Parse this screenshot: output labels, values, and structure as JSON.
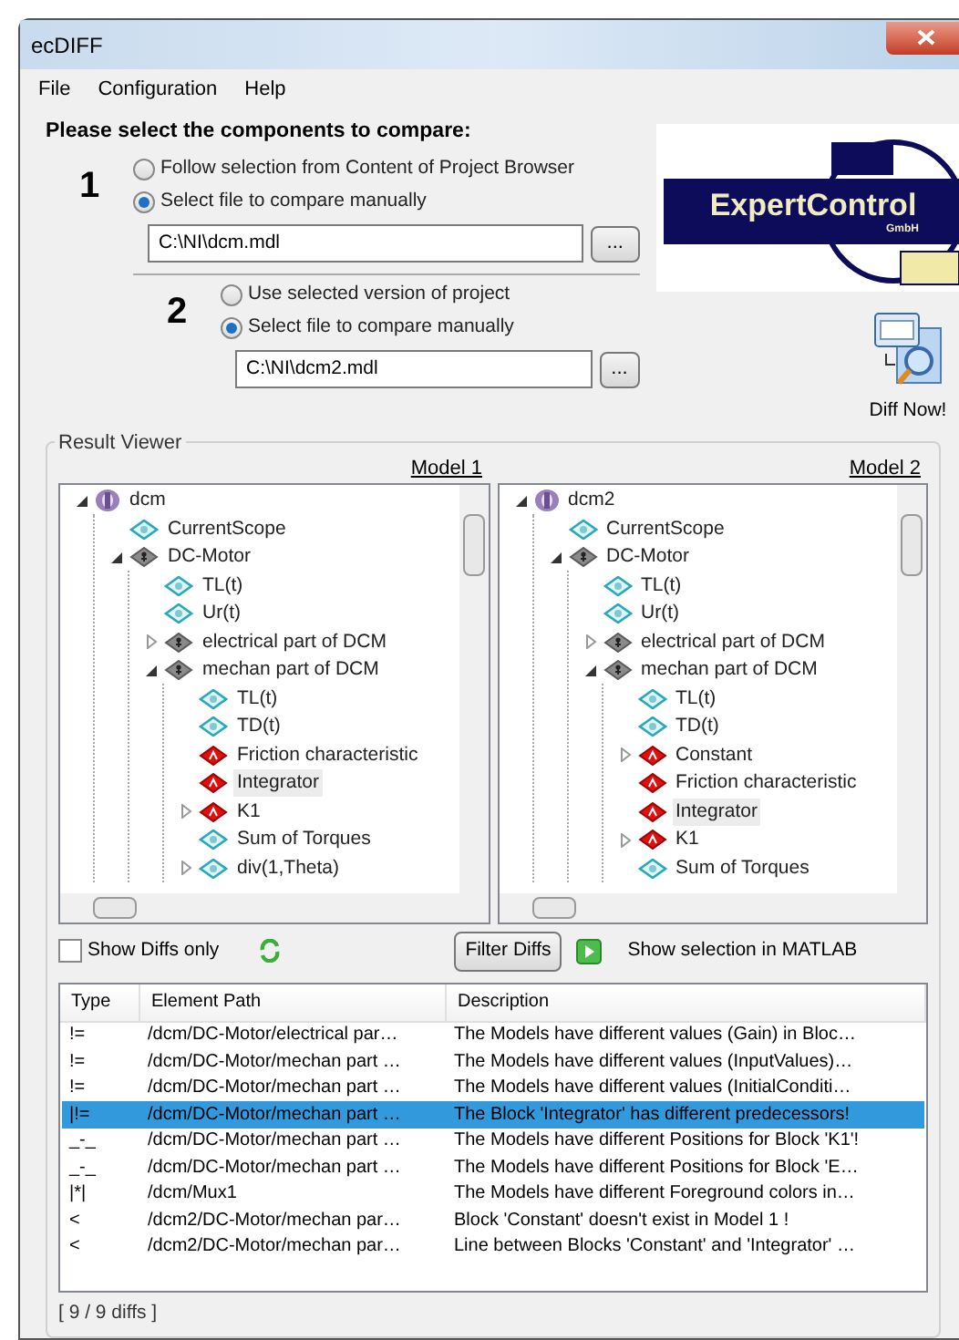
{
  "window": {
    "title": "ecDIFF"
  },
  "menu": [
    "File",
    "Configuration",
    "Help"
  ],
  "heading": "Please select the components to compare:",
  "sources": [
    {
      "number": "1",
      "options": [
        {
          "label": "Follow selection from Content of Project Browser",
          "selected": false
        },
        {
          "label": "Select file to compare manually",
          "selected": true
        }
      ],
      "path": "C:\\NI\\dcm.mdl",
      "browse": "..."
    },
    {
      "number": "2",
      "options": [
        {
          "label": "Use selected version of project",
          "selected": false
        },
        {
          "label": "Select file to compare manually",
          "selected": true
        }
      ],
      "path": "C:\\NI\\dcm2.mdl",
      "browse": "..."
    }
  ],
  "logo": {
    "name": "ExpertControl",
    "suffix": "GmbH"
  },
  "diff_button": "Diff Now!",
  "result_viewer": {
    "title": "Result Viewer",
    "models": [
      {
        "label": "Model 1",
        "tree": [
          {
            "label": "dcm",
            "kind": "model",
            "expanded": true,
            "selected": false,
            "children": [
              {
                "label": "CurrentScope",
                "kind": "block",
                "selected": false
              },
              {
                "label": "DC-Motor",
                "kind": "subsystem",
                "expanded": true,
                "selected": false,
                "children": [
                  {
                    "label": "TL(t)",
                    "kind": "block",
                    "selected": false
                  },
                  {
                    "label": "Ur(t)",
                    "kind": "block",
                    "selected": false
                  },
                  {
                    "label": "electrical part of DCM",
                    "kind": "subsystem",
                    "expanded": false,
                    "selected": false
                  },
                  {
                    "label": "mechan part of DCM",
                    "kind": "subsystem",
                    "expanded": true,
                    "selected": false,
                    "children": [
                      {
                        "label": "TL(t)",
                        "kind": "block",
                        "selected": false
                      },
                      {
                        "label": "TD(t)",
                        "kind": "block",
                        "selected": false
                      },
                      {
                        "label": "Friction characteristic",
                        "kind": "changed",
                        "selected": false
                      },
                      {
                        "label": "Integrator",
                        "kind": "changed",
                        "selected": true
                      },
                      {
                        "label": "K1",
                        "kind": "changed",
                        "expanded": false,
                        "selected": false
                      },
                      {
                        "label": "Sum of Torques",
                        "kind": "block",
                        "selected": false
                      },
                      {
                        "label": "div(1,Theta)",
                        "kind": "block",
                        "expanded": false,
                        "selected": false
                      }
                    ]
                  }
                ]
              }
            ]
          }
        ]
      },
      {
        "label": "Model 2",
        "tree": [
          {
            "label": "dcm2",
            "kind": "model",
            "expanded": true,
            "selected": false,
            "children": [
              {
                "label": "CurrentScope",
                "kind": "block",
                "selected": false
              },
              {
                "label": "DC-Motor",
                "kind": "subsystem",
                "expanded": true,
                "selected": false,
                "children": [
                  {
                    "label": "TL(t)",
                    "kind": "block",
                    "selected": false
                  },
                  {
                    "label": "Ur(t)",
                    "kind": "block",
                    "selected": false
                  },
                  {
                    "label": "electrical part of DCM",
                    "kind": "subsystem",
                    "expanded": false,
                    "selected": false
                  },
                  {
                    "label": "mechan part of DCM",
                    "kind": "subsystem",
                    "expanded": true,
                    "selected": false,
                    "children": [
                      {
                        "label": "TL(t)",
                        "kind": "block",
                        "selected": false
                      },
                      {
                        "label": "TD(t)",
                        "kind": "block",
                        "selected": false
                      },
                      {
                        "label": "Constant",
                        "kind": "changed",
                        "expanded": false,
                        "selected": false
                      },
                      {
                        "label": "Friction characteristic",
                        "kind": "changed",
                        "selected": false
                      },
                      {
                        "label": "Integrator",
                        "kind": "changed",
                        "selected": true
                      },
                      {
                        "label": "K1",
                        "kind": "changed",
                        "expanded": false,
                        "selected": false
                      },
                      {
                        "label": "Sum of Torques",
                        "kind": "block",
                        "selected": false
                      }
                    ]
                  }
                ]
              }
            ]
          }
        ]
      }
    ],
    "show_diffs_only": {
      "label": "Show Diffs only",
      "checked": false
    },
    "filter_button": "Filter Diffs",
    "matlab_label": "Show selection in MATLAB",
    "table": {
      "columns": [
        "Type",
        "Element Path",
        "Description"
      ],
      "rows": [
        {
          "cells": [
            "!=",
            "/dcm/DC-Motor/electrical par…",
            "The Models have different values (Gain) in Bloc…"
          ],
          "selected": false
        },
        {
          "cells": [
            "!=",
            "/dcm/DC-Motor/mechan part …",
            "The Models have different values (InputValues)…"
          ],
          "selected": false
        },
        {
          "cells": [
            "!=",
            "/dcm/DC-Motor/mechan part …",
            "The Models have different values (InitialConditi…"
          ],
          "selected": false
        },
        {
          "cells": [
            "|!=",
            "/dcm/DC-Motor/mechan part …",
            "The Block 'Integrator' has different predecessors!"
          ],
          "selected": true
        },
        {
          "cells": [
            "_-_",
            "/dcm/DC-Motor/mechan part …",
            "The Models have different Positions for Block 'K1'!"
          ],
          "selected": false
        },
        {
          "cells": [
            "_-_",
            "/dcm/DC-Motor/mechan part …",
            "The Models have different Positions for Block 'E…"
          ],
          "selected": false
        },
        {
          "cells": [
            "|*|",
            "/dcm/Mux1",
            "The Models have different Foreground colors in…"
          ],
          "selected": false
        },
        {
          "cells": [
            "<",
            "/dcm2/DC-Motor/mechan par…",
            "Block 'Constant' doesn't exist in Model 1 !"
          ],
          "selected": false
        },
        {
          "cells": [
            "<",
            "/dcm2/DC-Motor/mechan par…",
            "Line between Blocks 'Constant' and 'Integrator' …"
          ],
          "selected": false
        }
      ]
    },
    "status": "[ 9 / 9 diffs ]"
  }
}
